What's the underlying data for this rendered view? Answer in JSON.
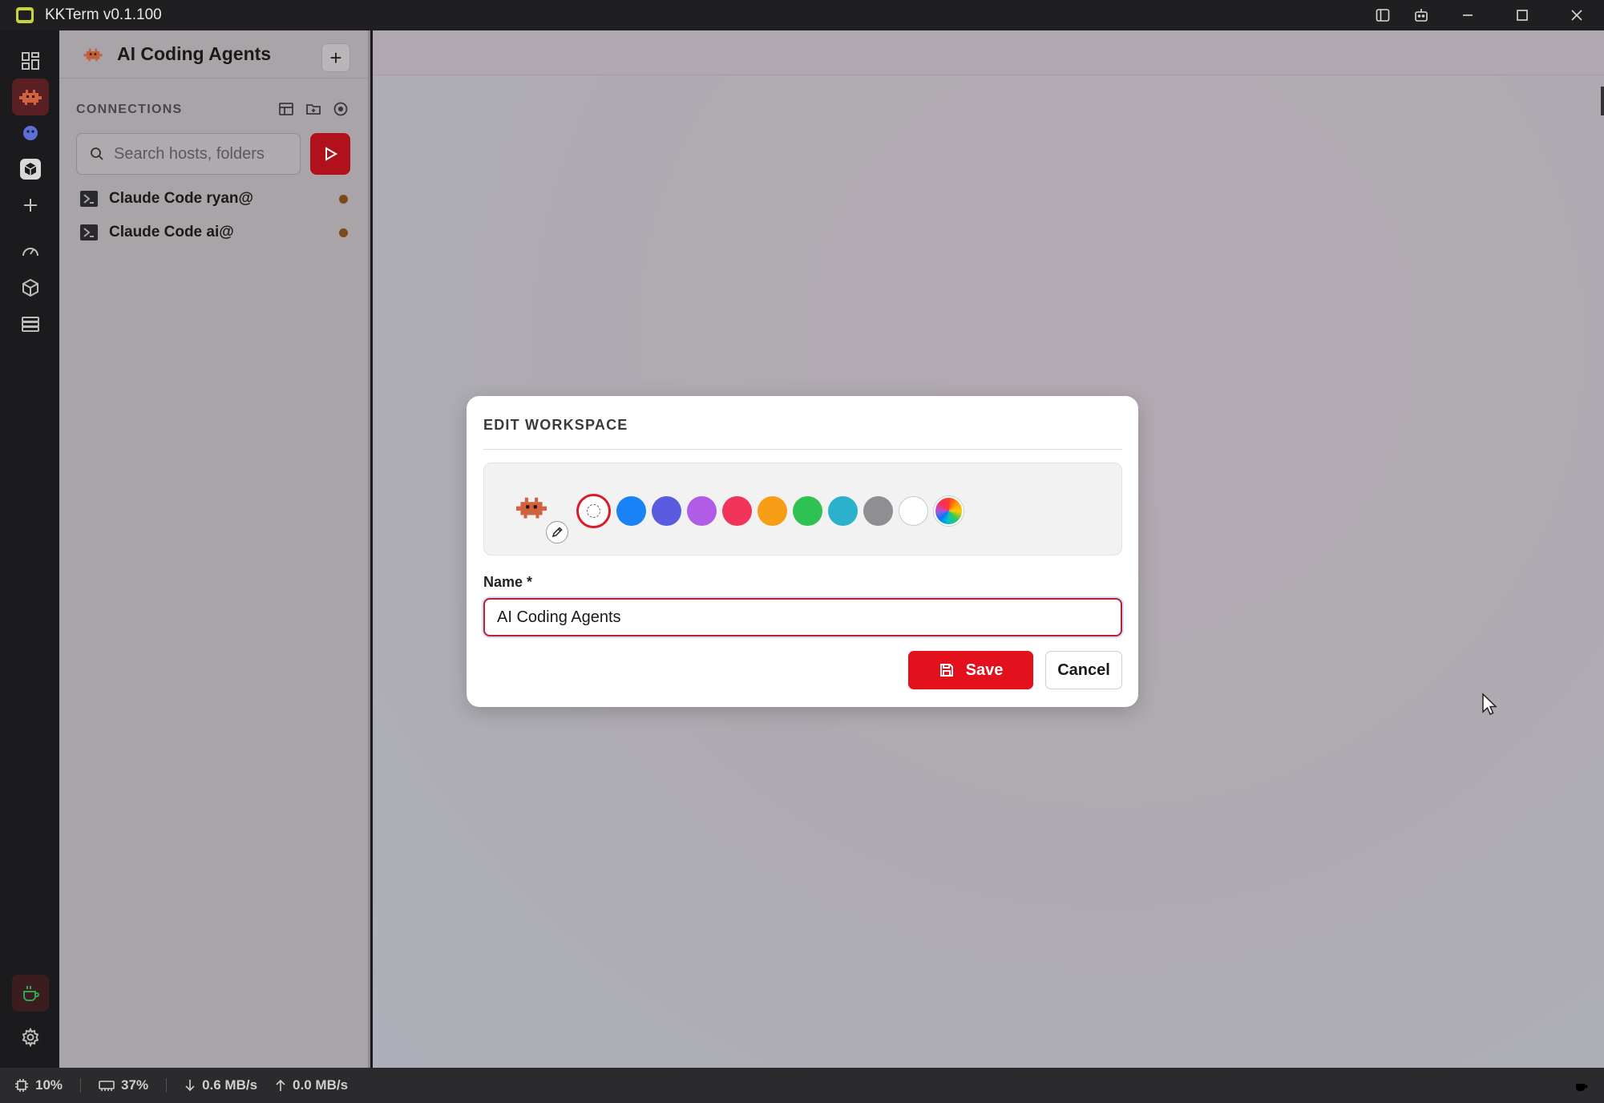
{
  "window": {
    "title": "KKTerm v0.1.100"
  },
  "sidebar": {
    "workspace_title": "AI Coding Agents",
    "connections_header": "CONNECTIONS",
    "search_placeholder": "Search hosts, folders",
    "connections": [
      {
        "label": "Claude Code ryan@"
      },
      {
        "label": "Claude Code ai@"
      }
    ]
  },
  "dialog": {
    "title": "EDIT WORKSPACE",
    "name_label": "Name *",
    "name_value": "AI Coding Agents",
    "save_label": "Save",
    "cancel_label": "Cancel",
    "colors": [
      "#1a82f7",
      "#5b5bdf",
      "#b05ce6",
      "#f0345a",
      "#f79d16",
      "#2ec252",
      "#2bb1cc",
      "#8e8e93",
      "#ffffff"
    ]
  },
  "status": {
    "cpu": "10%",
    "memory": "37%",
    "download": "0.6 MB/s",
    "upload": "0.0 MB/s"
  },
  "colors": {
    "accent": "#e3101d",
    "rail_active": "#5a1f22",
    "workspace_icon": "#d0633f"
  }
}
